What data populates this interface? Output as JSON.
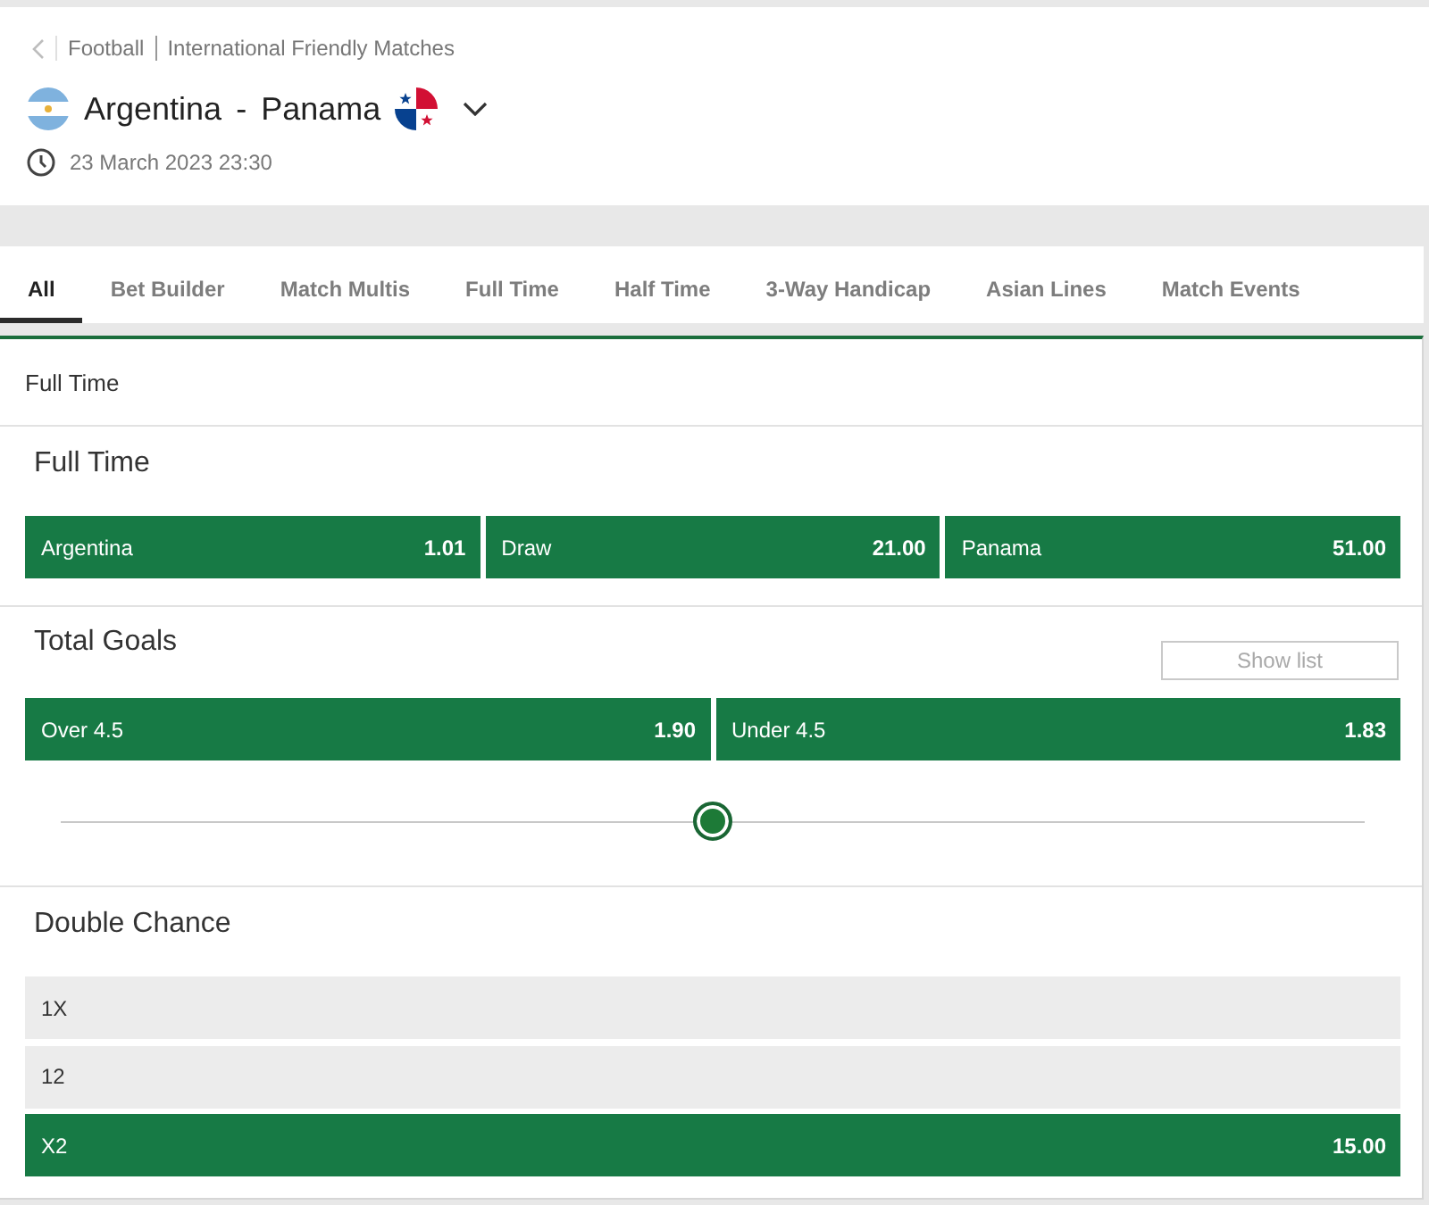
{
  "breadcrumb": {
    "items": [
      "Football",
      "International Friendly Matches"
    ]
  },
  "match": {
    "home": "Argentina",
    "separator": "-",
    "away": "Panama",
    "date": "23 March 2023 23:30"
  },
  "tabs": [
    {
      "label": "All",
      "selected": true
    },
    {
      "label": "Bet Builder",
      "selected": false
    },
    {
      "label": "Match Multis",
      "selected": false
    },
    {
      "label": "Full Time",
      "selected": false
    },
    {
      "label": "Half Time",
      "selected": false
    },
    {
      "label": "3-Way Handicap",
      "selected": false
    },
    {
      "label": "Asian Lines",
      "selected": false
    },
    {
      "label": "Match Events",
      "selected": false
    }
  ],
  "section_heading": "Full Time",
  "markets": [
    {
      "kind": "grid",
      "title": "Full Time",
      "selections": [
        {
          "name": "Argentina",
          "odds": "1.01",
          "disabled": false
        },
        {
          "name": "Draw",
          "odds": "21.00",
          "disabled": false
        },
        {
          "name": "Panama",
          "odds": "51.00",
          "disabled": false
        }
      ]
    },
    {
      "kind": "line",
      "title": "Total Goals",
      "show_list": "Show list",
      "selections": [
        {
          "name": "Over 4.5",
          "odds": "1.90",
          "disabled": false
        },
        {
          "name": "Under 4.5",
          "odds": "1.83",
          "disabled": false
        }
      ],
      "slider": {
        "level": 0.5
      }
    },
    {
      "kind": "list",
      "title": "Double Chance",
      "selections": [
        {
          "name": "1X",
          "disabled": true
        },
        {
          "name": "12",
          "disabled": true
        },
        {
          "name": "X2",
          "odds": "15.00",
          "disabled": false
        }
      ]
    }
  ]
}
